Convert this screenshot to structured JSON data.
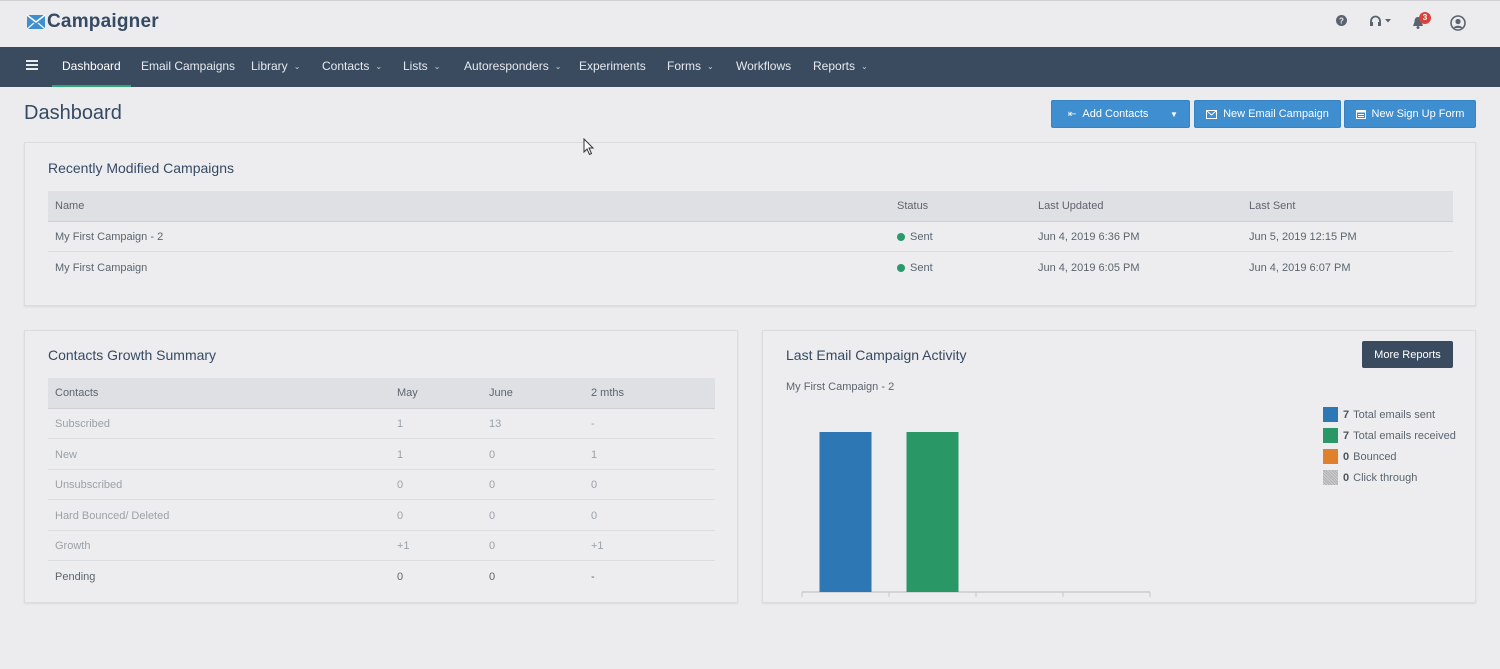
{
  "app": {
    "logo_text": "Campaigner",
    "notifications_count": "3"
  },
  "nav": {
    "items": [
      {
        "label": "Dashboard",
        "dropdown": false,
        "active": true
      },
      {
        "label": "Email Campaigns",
        "dropdown": false
      },
      {
        "label": "Library",
        "dropdown": true
      },
      {
        "label": "Contacts",
        "dropdown": true
      },
      {
        "label": "Lists",
        "dropdown": true
      },
      {
        "label": "Autoresponders",
        "dropdown": true
      },
      {
        "label": "Experiments",
        "dropdown": false
      },
      {
        "label": "Forms",
        "dropdown": true
      },
      {
        "label": "Workflows",
        "dropdown": false
      },
      {
        "label": "Reports",
        "dropdown": true
      }
    ]
  },
  "page": {
    "title": "Dashboard",
    "buttons": {
      "add_contacts": "Add Contacts",
      "new_email_campaign": "New Email Campaign",
      "new_sign_up_form": "New Sign Up Form"
    }
  },
  "recent_campaigns": {
    "title": "Recently Modified Campaigns",
    "columns": [
      "Name",
      "Status",
      "Last Updated",
      "Last Sent"
    ],
    "rows": [
      {
        "name": "My First Campaign - 2",
        "status": "Sent",
        "last_updated": "Jun 4, 2019 6:36 PM",
        "last_sent": "Jun 5, 2019 12:15 PM"
      },
      {
        "name": "My First Campaign",
        "status": "Sent",
        "last_updated": "Jun 4, 2019 6:05 PM",
        "last_sent": "Jun 4, 2019 6:07 PM"
      }
    ]
  },
  "contacts_growth": {
    "title": "Contacts Growth Summary",
    "columns": [
      "Contacts",
      "May",
      "June",
      "2 mths"
    ],
    "rows": [
      {
        "label": "Subscribed",
        "may": "1",
        "june": "13",
        "two_months": "-"
      },
      {
        "label": "New",
        "may": "1",
        "june": "0",
        "two_months": "1"
      },
      {
        "label": "Unsubscribed",
        "may": "0",
        "june": "0",
        "two_months": "0"
      },
      {
        "label": "Hard Bounced/ Deleted",
        "may": "0",
        "june": "0",
        "two_months": "0"
      },
      {
        "label": "Growth",
        "may": "+1",
        "june": "0",
        "two_months": "+1"
      },
      {
        "label": "Pending",
        "may": "0",
        "june": "0",
        "two_months": "-"
      }
    ]
  },
  "campaign_activity": {
    "title": "Last Email Campaign Activity",
    "more_reports_label": "More Reports",
    "campaign_name": "My First Campaign - 2",
    "legend": [
      {
        "value": "7",
        "label": "Total emails sent",
        "color": "#2c77b4"
      },
      {
        "value": "7",
        "label": "Total emails received",
        "color": "#2a9866"
      },
      {
        "value": "0",
        "label": "Bounced",
        "color": "#e07f2c"
      },
      {
        "value": "0",
        "label": "Click through",
        "color": "#b8b8bc"
      }
    ]
  },
  "chart_data": {
    "type": "bar",
    "title": "",
    "categories": [
      "Total emails sent",
      "Total emails received",
      "Bounced",
      "Click through"
    ],
    "values": [
      7,
      7,
      0,
      0
    ],
    "colors": [
      "#2c77b4",
      "#2a9866",
      "#e07f2c",
      "#b8b8bc"
    ],
    "xlabel": "",
    "ylabel": "",
    "ylim": [
      0,
      7
    ],
    "grid": false,
    "legend": "right"
  }
}
